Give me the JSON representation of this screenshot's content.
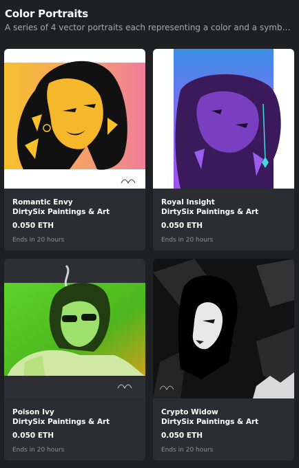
{
  "collection": {
    "title": "Color Portraits",
    "description": "A series of 4 vector portraits each representing a color and a symbol that..."
  },
  "cards": [
    {
      "name": "Romantic Envy",
      "creator": "DirtySix Paintings & Art",
      "price": "0.050 ETH",
      "ends": "Ends in 20 hours"
    },
    {
      "name": "Royal Insight",
      "creator": "DirtySix Paintings & Art",
      "price": "0.050 ETH",
      "ends": "Ends in 20 hours"
    },
    {
      "name": "Poison Ivy",
      "creator": "DirtySix Paintings & Art",
      "price": "0.050 ETH",
      "ends": "Ends in 20 hours"
    },
    {
      "name": "Crypto Widow",
      "creator": "DirtySix Paintings & Art",
      "price": "0.050 ETH",
      "ends": "Ends in 20 hours"
    }
  ],
  "colors": {
    "background": "#1f2024",
    "card": "#2c2d33",
    "muted_text": "#8f9197"
  }
}
